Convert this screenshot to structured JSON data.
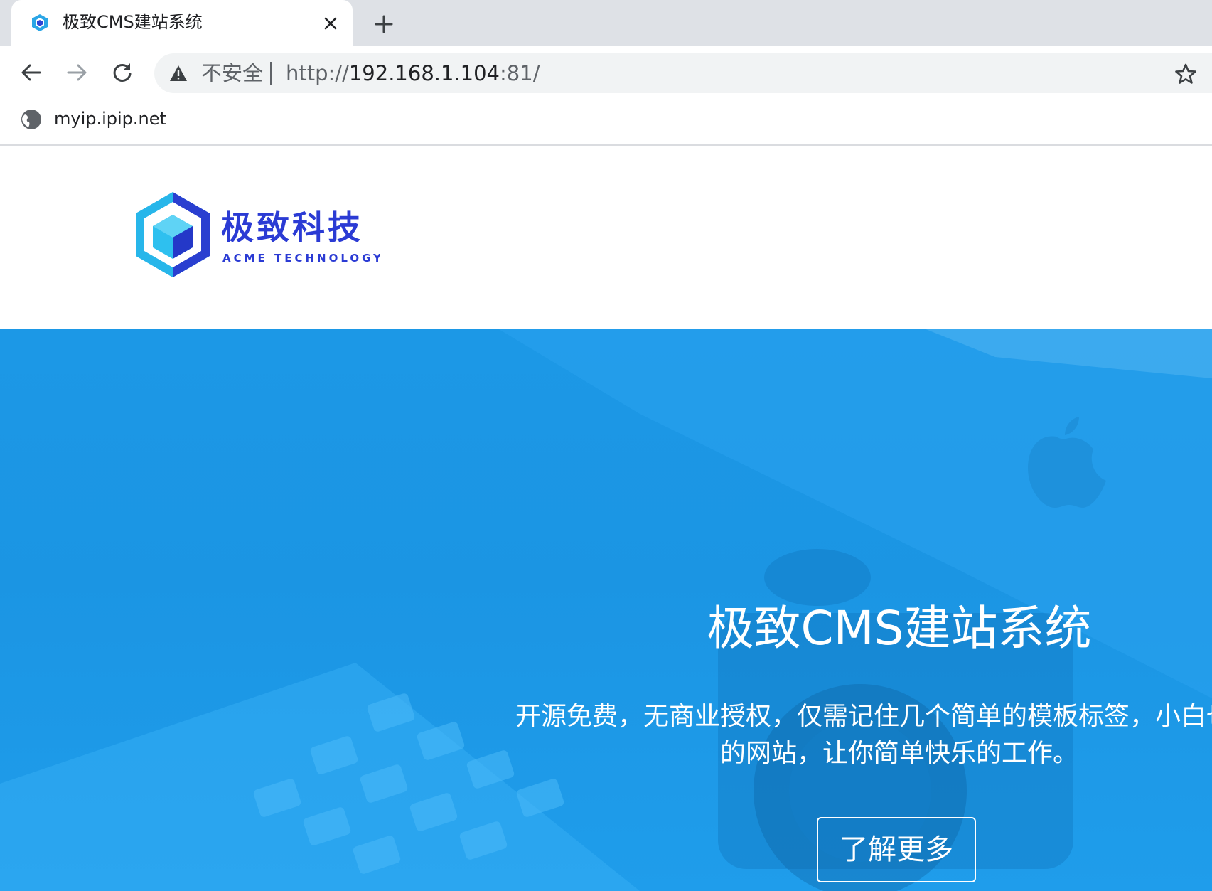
{
  "browser": {
    "tab": {
      "title": "极致CMS建站系统",
      "favicon": "hexagon-cube-icon",
      "close_icon": "close-icon"
    },
    "new_tab_icon": "plus-icon",
    "toolbar": {
      "back_icon": "arrow-left-icon",
      "forward_icon": "arrow-right-icon",
      "reload_icon": "reload-icon",
      "security_label": "不安全",
      "security_icon": "warning-triangle-icon",
      "url_scheme": "http://",
      "url_host": "192.168.1.104",
      "url_port": ":81/",
      "bookmark_icon": "star-icon"
    },
    "bookmarks": [
      {
        "label": "myip.ipip.net",
        "icon": "globe-icon"
      }
    ]
  },
  "page": {
    "logo": {
      "name": "极致科技",
      "subtitle": "ACME TECHNOLOGY"
    },
    "hero": {
      "title": "极致CMS建站系统",
      "description_line1": "开源免费，无商业授权，仅需记住几个简单的模板标签，小白也能搭",
      "description_line2": "的网站，让你简单快乐的工作。",
      "button_label": "了解更多"
    }
  },
  "colors": {
    "tabstrip": "#dee1e6",
    "omnibox": "#f1f3f4",
    "hero_blue": "#1b96e4",
    "logo_blue": "#2b3bd4",
    "logo_cyan": "#28b9ea"
  }
}
